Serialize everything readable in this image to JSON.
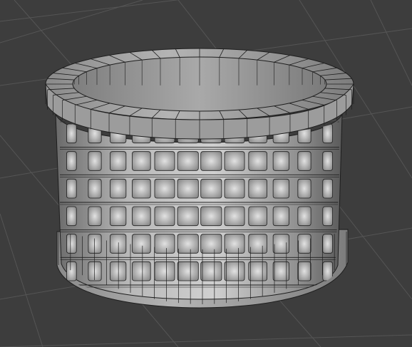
{
  "viewport": {
    "background": "#3d3d3d",
    "grid_color": "#555555",
    "object": {
      "type": "cylinder-basket-mesh",
      "body_color": "#9a9a9a",
      "highlight_color": "#d6d6d6",
      "shadow_color": "#5e5e5e",
      "wire_color": "#1e1e1e",
      "rows": 6,
      "columns": 12,
      "display": "wireframe-overlay",
      "icon": "mesh-object-icon"
    }
  }
}
